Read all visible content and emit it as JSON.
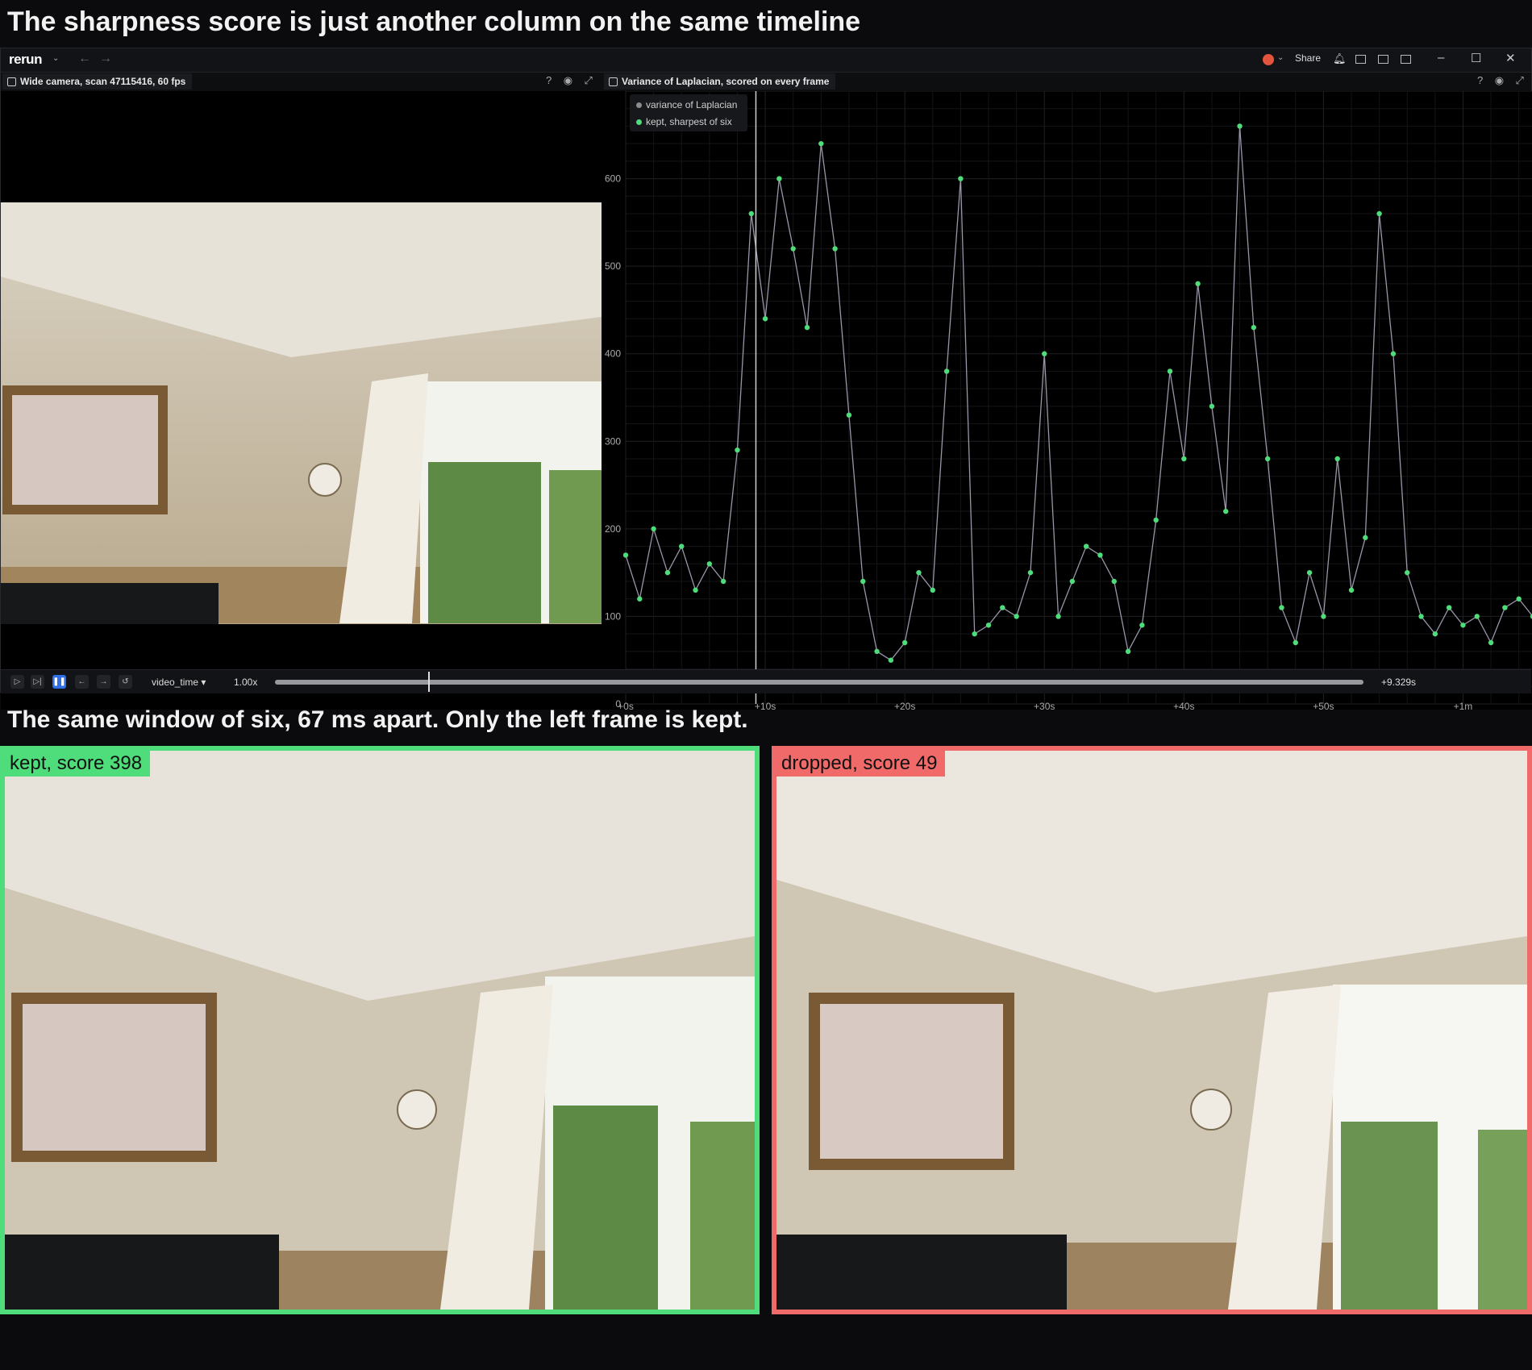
{
  "headline": "The sharpness score is just another column on the same timeline",
  "subheadline": "The same window of six, 67 ms apart. Only the left frame is kept.",
  "app": {
    "logo": "rerun",
    "share_label": "Share"
  },
  "video_panel": {
    "title": "Wide camera, scan 47115416, 60 fps"
  },
  "plot_panel": {
    "title": "Variance of Laplacian, scored on every frame",
    "legend": [
      "variance of Laplacian",
      "kept, sharpest of six"
    ]
  },
  "timebar": {
    "timeline_name": "video_time",
    "speed": "1.00x",
    "current_time": "+9.329s"
  },
  "frames": [
    {
      "label": "kept, score 398"
    },
    {
      "label": "dropped, score 49"
    }
  ],
  "colors": {
    "series": "#9a95a8",
    "kept": "#4fdc7a",
    "dropped": "#f06a6a",
    "accent": "#2f6fe6"
  },
  "chart_data": {
    "type": "line",
    "title": "Variance of Laplacian, scored on every frame",
    "xlabel": "",
    "ylabel": "",
    "x_tick_labels": [
      "+0s",
      "+10s",
      "+20s",
      "+30s",
      "+40s",
      "+50s",
      "+1m"
    ],
    "y_tick_labels": [
      "0",
      "100",
      "200",
      "300",
      "400",
      "500",
      "600"
    ],
    "xlim": [
      0,
      65
    ],
    "ylim": [
      0,
      700
    ],
    "grid": true,
    "legend_position": "top-left",
    "cursor_x": 9.329,
    "series": [
      {
        "name": "variance of Laplacian",
        "color": "#9a95a8",
        "x": [
          0,
          1,
          2,
          3,
          4,
          5,
          6,
          7,
          8,
          9,
          10,
          11,
          12,
          13,
          14,
          15,
          16,
          17,
          18,
          19,
          20,
          21,
          22,
          23,
          24,
          25,
          26,
          27,
          28,
          29,
          30,
          31,
          32,
          33,
          34,
          35,
          36,
          37,
          38,
          39,
          40,
          41,
          42,
          43,
          44,
          45,
          46,
          47,
          48,
          49,
          50,
          51,
          52,
          53,
          54,
          55,
          56,
          57,
          58,
          59,
          60,
          61,
          62,
          63,
          64,
          65
        ],
        "y": [
          170,
          120,
          200,
          150,
          180,
          130,
          160,
          140,
          290,
          560,
          440,
          600,
          520,
          430,
          640,
          520,
          330,
          140,
          60,
          50,
          70,
          150,
          130,
          380,
          600,
          80,
          90,
          110,
          100,
          150,
          400,
          100,
          140,
          180,
          170,
          140,
          60,
          90,
          210,
          380,
          280,
          480,
          340,
          220,
          660,
          430,
          280,
          110,
          70,
          150,
          100,
          280,
          130,
          190,
          560,
          400,
          150,
          100,
          80,
          110,
          90,
          100,
          70,
          110,
          120,
          100
        ]
      },
      {
        "name": "kept, sharpest of six",
        "color": "#4fdc7a",
        "x": [
          0,
          1,
          2,
          3,
          4,
          5,
          6,
          7,
          8,
          9,
          10,
          11,
          12,
          13,
          14,
          15,
          16,
          17,
          18,
          19,
          20,
          21,
          22,
          23,
          24,
          25,
          26,
          27,
          28,
          29,
          30,
          31,
          32,
          33,
          34,
          35,
          36,
          37,
          38,
          39,
          40,
          41,
          42,
          43,
          44,
          45,
          46,
          47,
          48,
          49,
          50,
          51,
          52,
          53,
          54,
          55,
          56,
          57,
          58,
          59,
          60,
          61,
          62,
          63,
          64,
          65
        ],
        "y": [
          170,
          120,
          200,
          150,
          180,
          130,
          160,
          140,
          290,
          560,
          440,
          600,
          520,
          430,
          640,
          520,
          330,
          140,
          60,
          50,
          70,
          150,
          130,
          380,
          600,
          80,
          90,
          110,
          100,
          150,
          400,
          100,
          140,
          180,
          170,
          140,
          60,
          90,
          210,
          380,
          280,
          480,
          340,
          220,
          660,
          430,
          280,
          110,
          70,
          150,
          100,
          280,
          130,
          190,
          560,
          400,
          150,
          100,
          80,
          110,
          90,
          100,
          70,
          110,
          120,
          100
        ]
      }
    ]
  }
}
